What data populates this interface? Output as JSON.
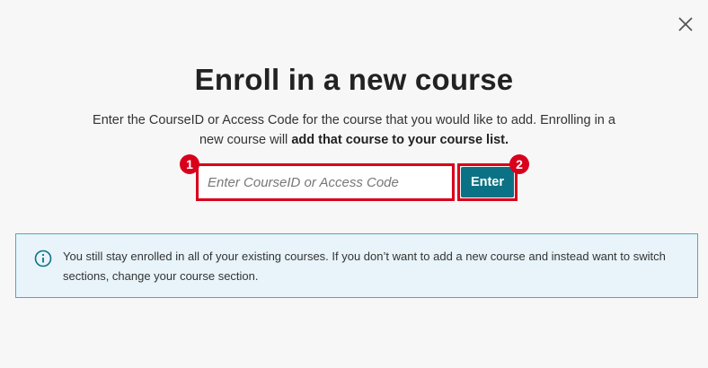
{
  "dialog": {
    "title": "Enroll in a new course",
    "description_part1": "Enter the CourseID or Access Code for the course that you would like to add. Enrolling in a new course will ",
    "description_bold": "add that course to your course list.",
    "course_input": {
      "placeholder": "Enter CourseID or Access Code",
      "value": ""
    },
    "enter_label": "Enter",
    "callouts": [
      "1",
      "2"
    ],
    "info_text": "You still stay enrolled in all of your existing courses. If you don’t want to add a new course and instead want to switch sections, change your course section."
  },
  "colors": {
    "primary": "#0b7285",
    "callout": "#d9001b",
    "info_bg": "#e8f4fa",
    "info_border": "#5ba4b8"
  },
  "icons": {
    "close": "close-icon",
    "info": "info-circle-icon"
  }
}
